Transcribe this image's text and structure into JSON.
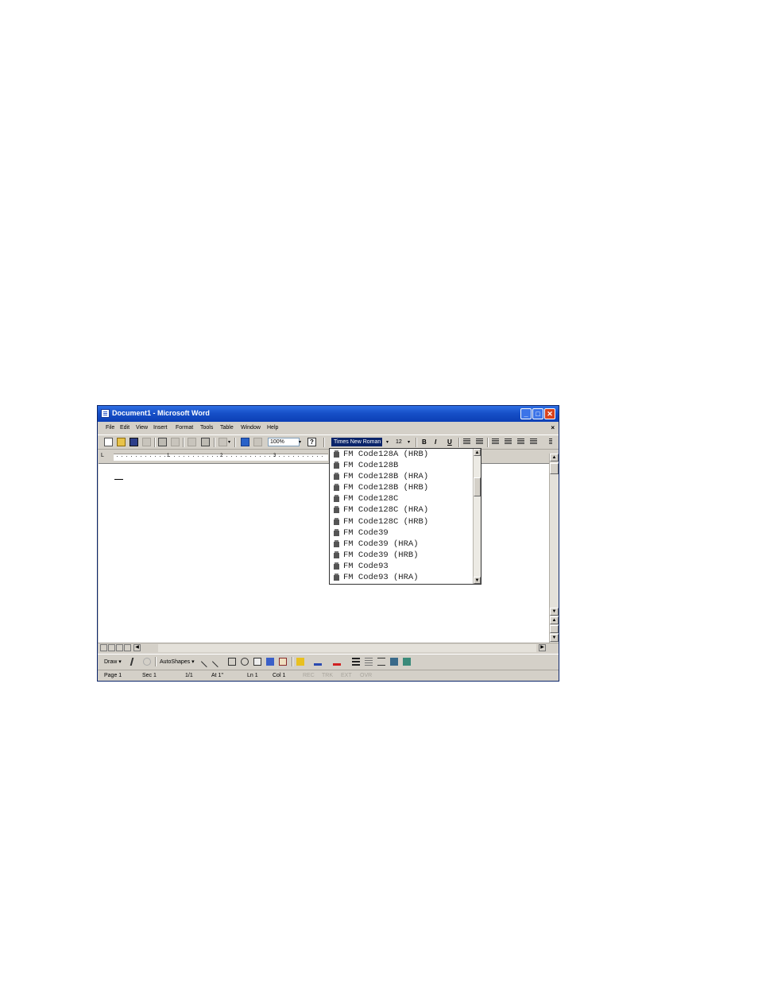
{
  "window": {
    "title": "Document1 - Microsoft Word",
    "minimize_label": "_",
    "maximize_label": "□",
    "close_label": "✕"
  },
  "menu": {
    "items": [
      "File",
      "Edit",
      "View",
      "Insert",
      "Format",
      "Tools",
      "Table",
      "Window",
      "Help"
    ],
    "doc_close": "×"
  },
  "toolbar": {
    "zoom": "100%",
    "help_glyph": "?",
    "font_name": "Times New Roman",
    "font_size": "12",
    "bold": "B",
    "italic": "I",
    "underline": "U",
    "dropdown_arrow": "▾"
  },
  "ruler": {
    "numbers": [
      "1",
      "2",
      "3"
    ],
    "tab_selector": "L"
  },
  "font_dropdown": {
    "items": [
      "FM Code128A (HRB)",
      "FM Code128B",
      "FM Code128B (HRA)",
      "FM Code128B (HRB)",
      "FM Code128C",
      "FM Code128C (HRA)",
      "FM Code128C (HRB)",
      "FM Code39",
      "FM Code39 (HRA)",
      "FM Code39 (HRB)",
      "FM Code93",
      "FM Code93 (HRA)"
    ]
  },
  "drawing_toolbar": {
    "draw_label": "Draw ▾",
    "autoshapes_label": "AutoShapes ▾"
  },
  "status_bar": {
    "page": "Page 1",
    "section": "Sec 1",
    "page_of": "1/1",
    "at": "At 1\"",
    "line": "Ln 1",
    "col": "Col 1",
    "rec": "REC",
    "trk": "TRK",
    "ext": "EXT",
    "ovr": "OVR"
  },
  "scroll_glyphs": {
    "up": "▲",
    "down": "▼",
    "left": "◀",
    "right": "▶"
  },
  "colors": {
    "title_bar": "#1750c8",
    "chrome": "#d4d0c8",
    "selection": "#0a246a"
  }
}
